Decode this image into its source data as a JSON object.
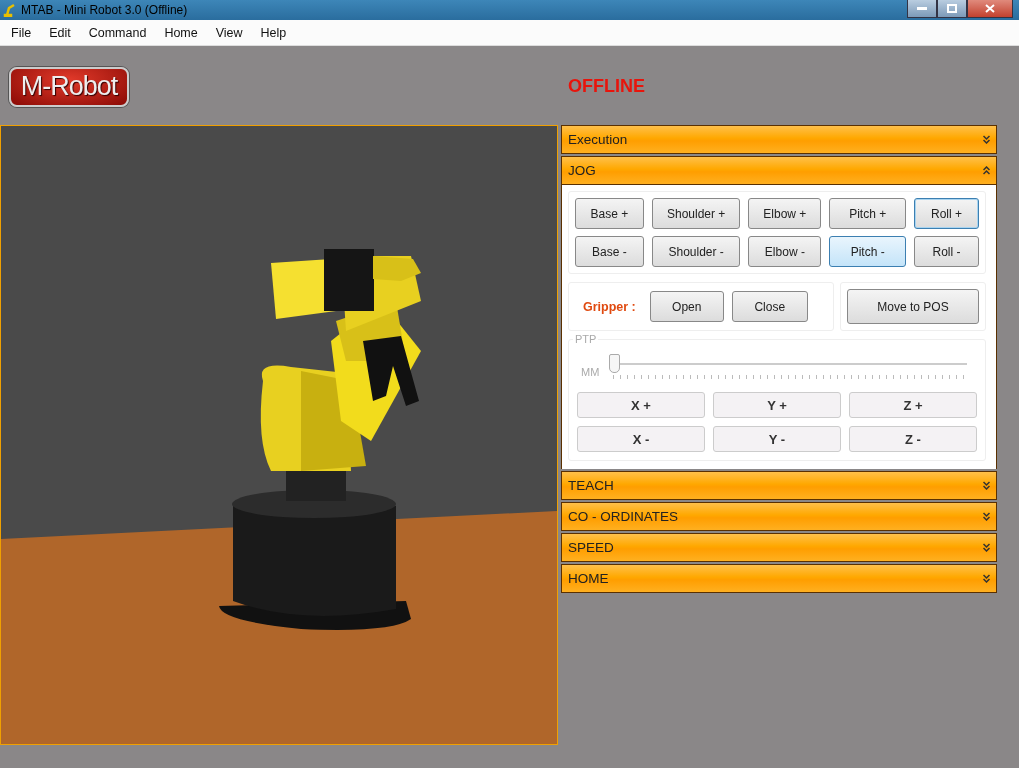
{
  "window": {
    "title": "MTAB - Mini Robot 3.0 (Offline)"
  },
  "menu": [
    "File",
    "Edit",
    "Command",
    "Home",
    "View",
    "Help"
  ],
  "logo": {
    "text": "M-Robot"
  },
  "status": "OFFLINE",
  "sections": [
    {
      "title": "Execution",
      "expanded": false
    },
    {
      "title": "JOG",
      "expanded": true
    },
    {
      "title": "TEACH",
      "expanded": false
    },
    {
      "title": "CO - ORDINATES",
      "expanded": false
    },
    {
      "title": "SPEED",
      "expanded": false
    },
    {
      "title": "HOME",
      "expanded": false
    }
  ],
  "jog": {
    "joint_buttons": [
      [
        {
          "label": "Base +",
          "focused": false,
          "hovered": false
        },
        {
          "label": "Shoulder +",
          "focused": false,
          "hovered": false
        },
        {
          "label": "Elbow +",
          "focused": false,
          "hovered": false
        },
        {
          "label": "Pitch +",
          "focused": false,
          "hovered": false
        },
        {
          "label": "Roll +",
          "focused": true,
          "hovered": false
        }
      ],
      [
        {
          "label": "Base -",
          "focused": false,
          "hovered": false
        },
        {
          "label": "Shoulder -",
          "focused": false,
          "hovered": false
        },
        {
          "label": "Elbow -",
          "focused": false,
          "hovered": false
        },
        {
          "label": "Pitch -",
          "focused": false,
          "hovered": true
        },
        {
          "label": "Roll -",
          "focused": false,
          "hovered": false
        }
      ]
    ],
    "gripper": {
      "label": "Gripper :",
      "buttons": [
        "Open",
        "Close"
      ]
    },
    "move_button": "Move to POS",
    "ptp": {
      "title": "PTP",
      "disabled": true,
      "unit": "MM",
      "level": 0,
      "buttons": [
        [
          "X +",
          "Y +",
          "Z +"
        ],
        [
          "X -",
          "Y -",
          "Z -"
        ]
      ]
    }
  }
}
